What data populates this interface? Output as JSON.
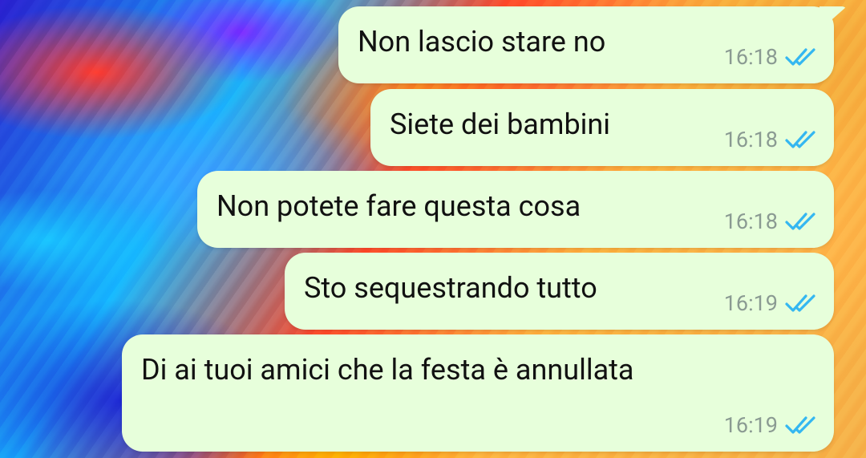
{
  "messages": [
    {
      "text": "Non lascio stare no",
      "time": "16:18",
      "status": "read"
    },
    {
      "text": "Siete dei bambini",
      "time": "16:18",
      "status": "read"
    },
    {
      "text": "Non potete fare questa cosa",
      "time": "16:18",
      "status": "read"
    },
    {
      "text": "Sto sequestrando tutto",
      "time": "16:19",
      "status": "read"
    },
    {
      "text": "Di ai tuoi amici che la festa è annullata",
      "time": "16:19",
      "status": "read"
    }
  ],
  "colors": {
    "outgoing_bubble": "#e7ffdb",
    "time_text": "#8a9a92",
    "read_ticks": "#34b7f1",
    "message_text": "#111111"
  },
  "icons": {
    "status": "double-check-icon"
  }
}
